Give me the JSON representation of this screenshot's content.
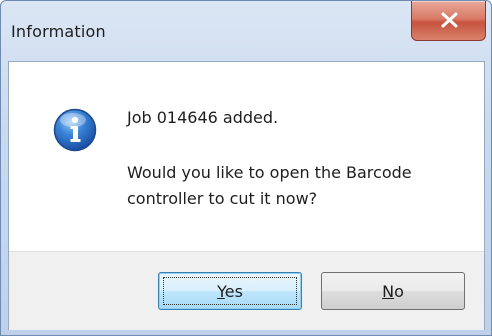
{
  "window": {
    "title": "Information"
  },
  "message": {
    "line1": "Job 014646 added.",
    "line2": "Would you like to open the Barcode controller to cut it now?",
    "icon": "info-icon"
  },
  "buttons": {
    "yes_label": "Yes",
    "no_label": "No"
  },
  "colors": {
    "close_button": "#d97a66",
    "info_icon": "#2a6fc9",
    "default_button_border": "#3c7fb1"
  }
}
